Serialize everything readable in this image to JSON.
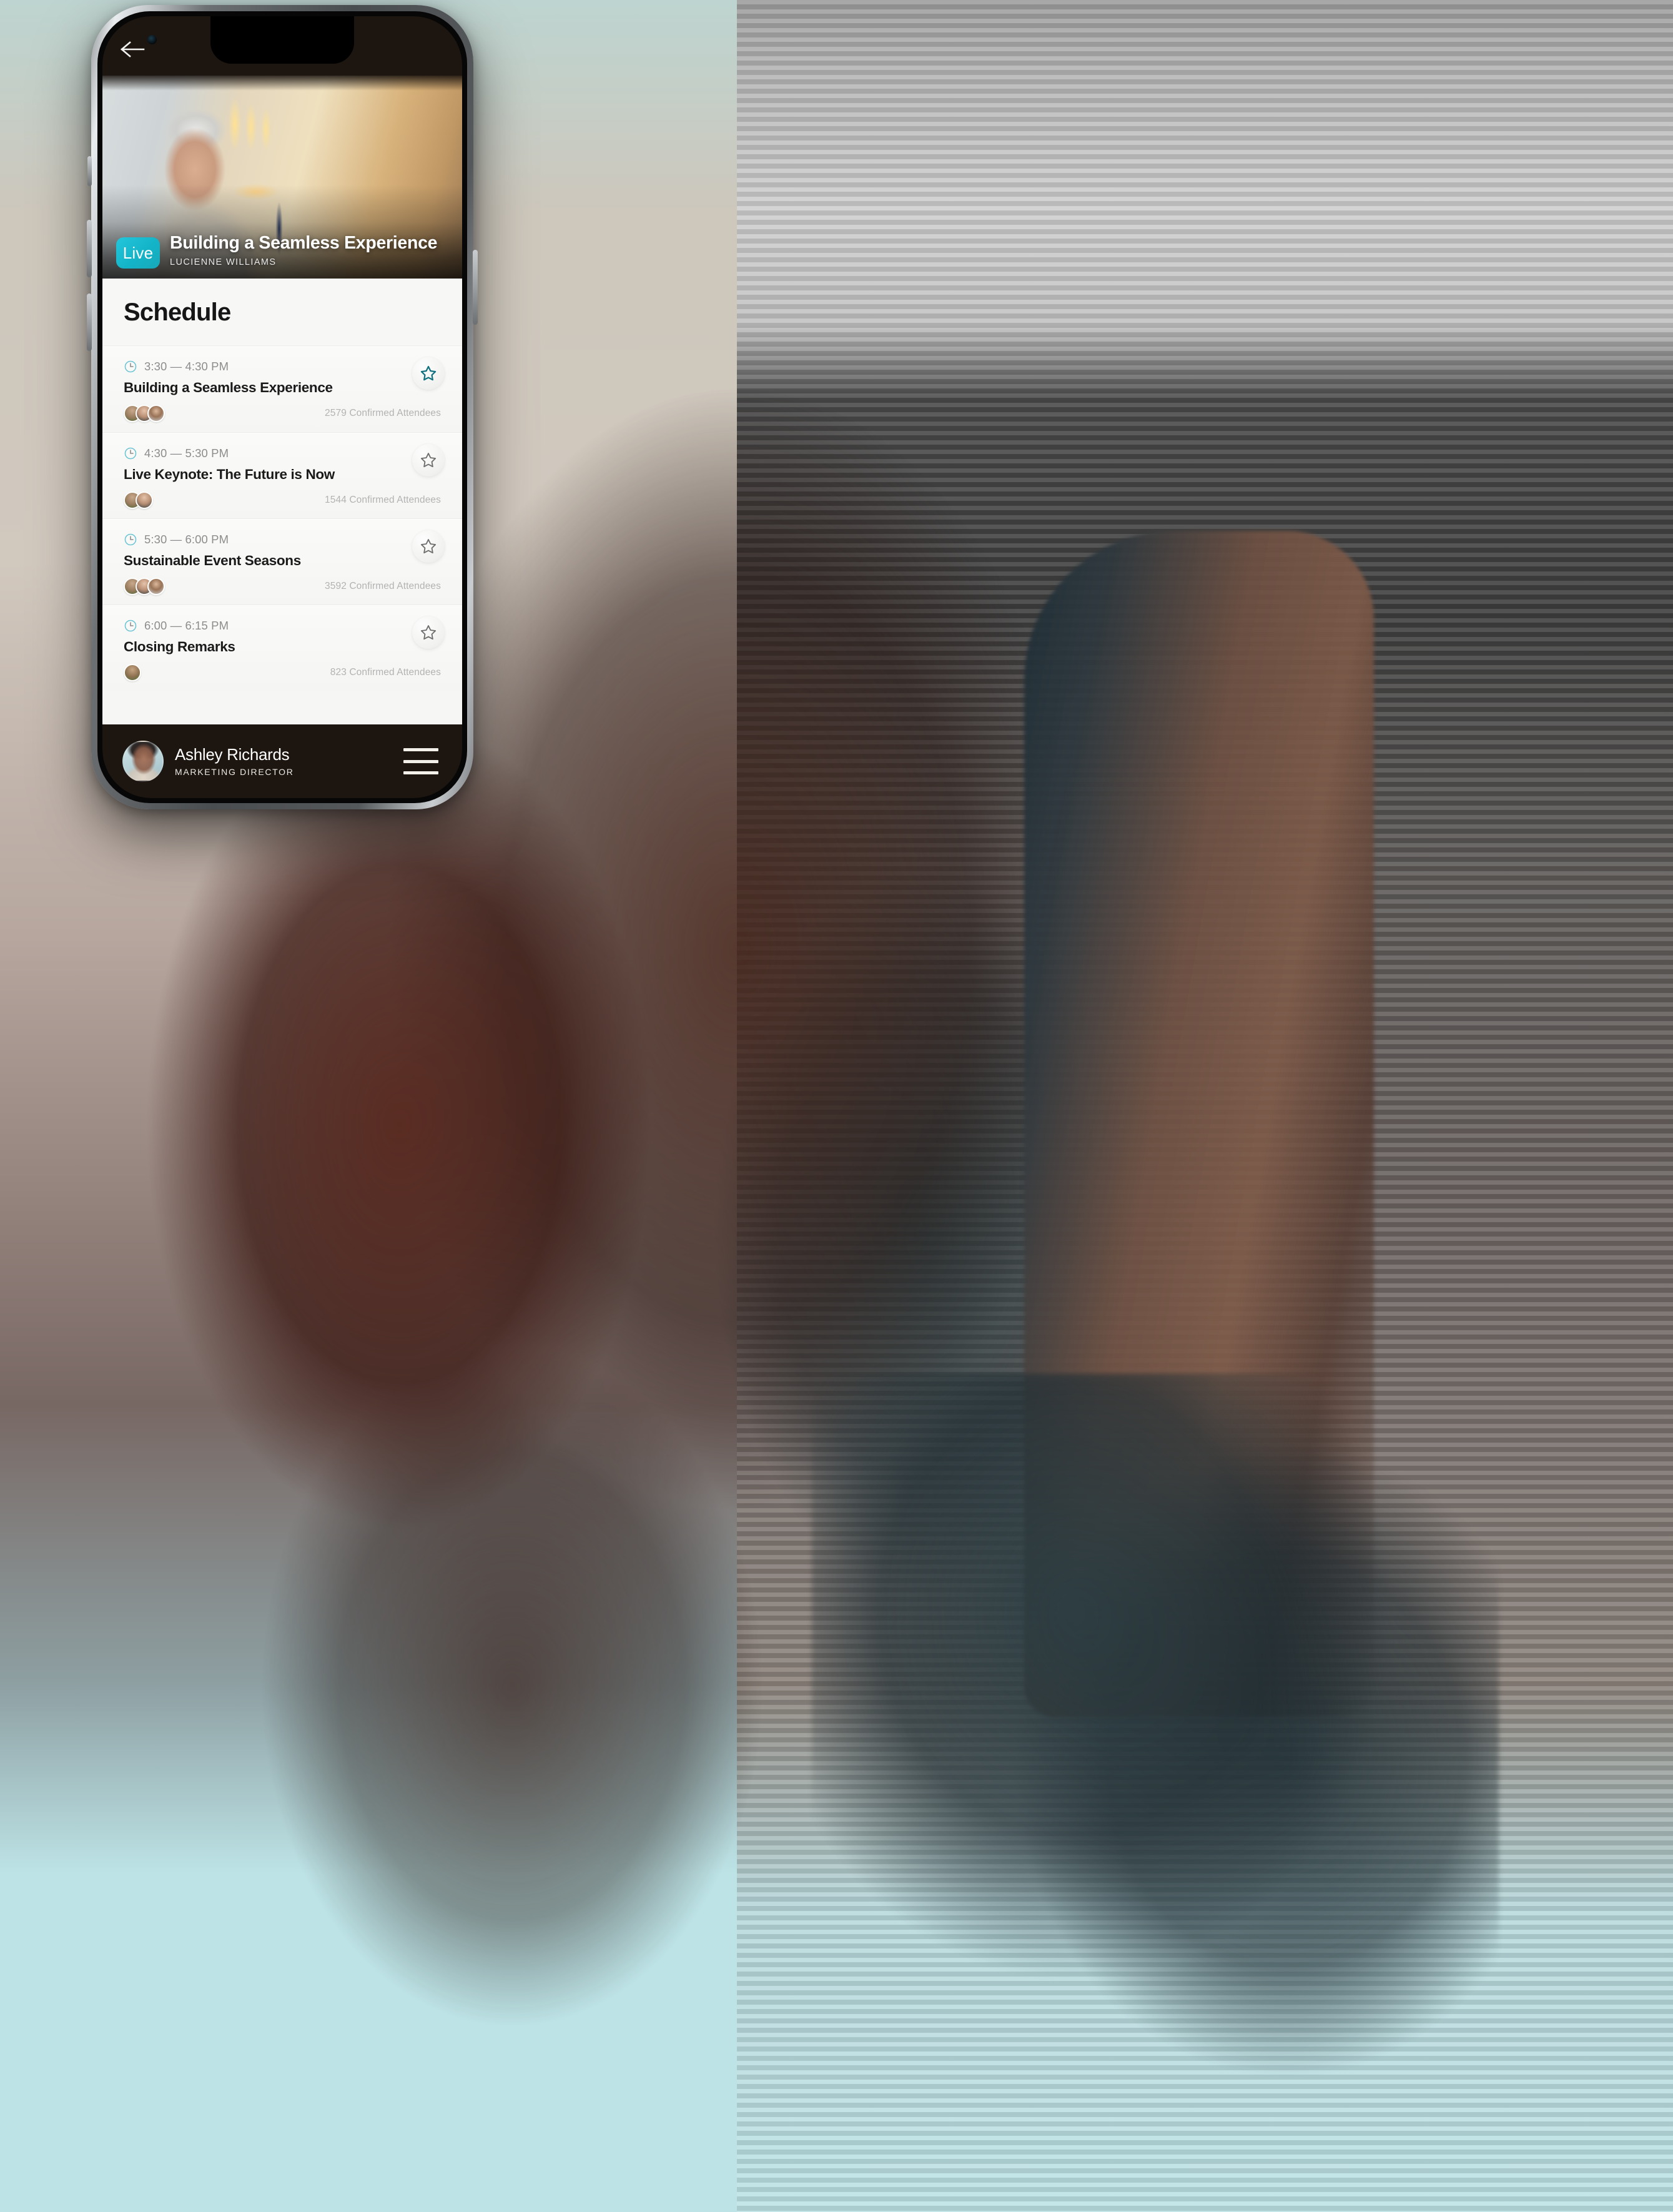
{
  "colors": {
    "accent_teal": "#14b4c8",
    "star_active": "#11717f",
    "star_inactive": "#6e6e6e",
    "clock_icon": "#6fc5d4",
    "bottom_bar": "#1c1510",
    "card_bg": "#f7f7f5"
  },
  "nav": {
    "back_label": "back-arrow"
  },
  "hero": {
    "badge": "Live",
    "title": "Building a Seamless Experience",
    "speaker": "LUCIENNE WILLIAMS"
  },
  "schedule": {
    "heading": "Schedule",
    "items": [
      {
        "time": "3:30 — 4:30 PM",
        "title": "Building a Seamless Experience",
        "attendees": "2579 Confirmed Attendees",
        "avatar_count": 3,
        "starred": true
      },
      {
        "time": "4:30 — 5:30 PM",
        "title": "Live Keynote: The Future is Now",
        "attendees": "1544 Confirmed Attendees",
        "avatar_count": 2,
        "starred": false
      },
      {
        "time": "5:30 — 6:00 PM",
        "title": "Sustainable Event Seasons",
        "attendees": "3592 Confirmed Attendees",
        "avatar_count": 3,
        "starred": false
      },
      {
        "time": "6:00 — 6:15 PM",
        "title": "Closing Remarks",
        "attendees": "823 Confirmed Attendees",
        "avatar_count": 1,
        "starred": false
      }
    ]
  },
  "bottom_bar": {
    "user_name": "Ashley Richards",
    "user_role": "MARKETING DIRECTOR",
    "menu_label": "hamburger-menu"
  }
}
